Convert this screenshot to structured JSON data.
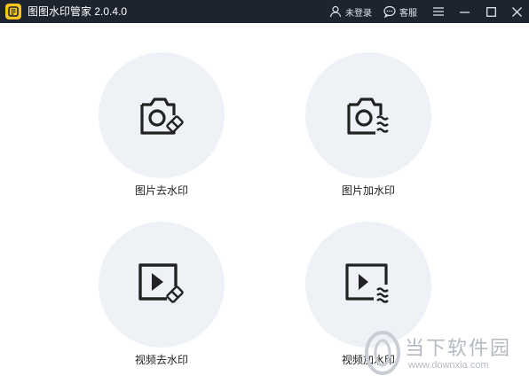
{
  "window": {
    "title": "图图水印管家  2.0.4.0",
    "login_label": "未登录",
    "service_label": "客服"
  },
  "cards": [
    {
      "label": "图片去水印",
      "icon": "camera-eraser-icon"
    },
    {
      "label": "图片加水印",
      "icon": "camera-waves-icon"
    },
    {
      "label": "视频去水印",
      "icon": "video-eraser-icon"
    },
    {
      "label": "视频加水印",
      "icon": "video-waves-icon"
    }
  ],
  "watermark": {
    "name": "当下软件园",
    "url": "www.downxia.com"
  },
  "colors": {
    "titlebar": "#1d2430",
    "card_circle": "#eef1f6",
    "logo": "#f7c51b"
  }
}
